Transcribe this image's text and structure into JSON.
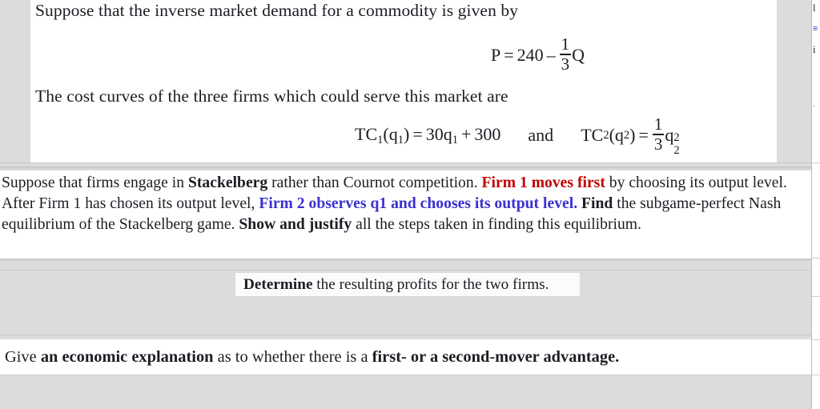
{
  "slide": {
    "background_color": "#dcdcdc",
    "panel_color": "#ffffff",
    "text_color": "#1c1c24",
    "accent_red": "#c00000",
    "accent_blue": "#3a31cf"
  },
  "demand_block": {
    "intro_line": "Suppose that the inverse market demand for a commodity is given by",
    "demand_equation": {
      "lhs": "P",
      "equals": "=",
      "constant": "240",
      "minus": "–",
      "fraction_numerator": "1",
      "fraction_denominator": "3",
      "variable": "Q",
      "plain_text": "P = 240 – (1/3)Q"
    },
    "cost_intro_line": "The cost curves of the three firms which could serve this market are",
    "cost_equations": {
      "firm1": {
        "function": "TC",
        "function_sub": "1",
        "arg": "q",
        "arg_sub": "1",
        "equals": "=",
        "coefficient": "30q",
        "coefficient_sub": "1",
        "plus": "+",
        "constant": "300",
        "plain_text": "TC1(q1) = 30q1 + 300"
      },
      "conjunction": "and",
      "firm2": {
        "function": "TC",
        "function_sub": "2",
        "arg": "q",
        "arg_sub": "2",
        "equals": "=",
        "fraction_numerator": "1",
        "fraction_denominator": "3",
        "variable": "q",
        "variable_sub": "2",
        "variable_sup": "2",
        "plain_text": "TC2(q2) = (1/3)q2^2"
      }
    }
  },
  "stackelberg_block": {
    "segments": [
      {
        "text": "Suppose that firms engage in ",
        "style": "normal"
      },
      {
        "text": "Stackelberg",
        "style": "bold"
      },
      {
        "text": " rather than Cournot competition. ",
        "style": "normal"
      },
      {
        "text": "Firm 1 moves first",
        "style": "red-bold"
      },
      {
        "text": " by choosing its output level. After Firm 1 has chosen its output level, ",
        "style": "normal"
      },
      {
        "text": "Firm 2 observes q1 and chooses its output level.",
        "style": "blue-bold"
      },
      {
        "text": " ",
        "style": "normal"
      },
      {
        "text": "Find",
        "style": "bold"
      },
      {
        "text": " the subgame-perfect Nash equilibrium of the Stackelberg game. ",
        "style": "normal"
      },
      {
        "text": "Show and justify",
        "style": "bold"
      },
      {
        "text": " all the steps taken in finding this equilibrium.",
        "style": "normal"
      }
    ]
  },
  "determine_block": {
    "segments": [
      {
        "text": "Determine",
        "style": "bold"
      },
      {
        "text": " the resulting profits for the two firms.",
        "style": "normal"
      }
    ]
  },
  "explanation_block": {
    "segments": [
      {
        "text": "Give ",
        "style": "normal"
      },
      {
        "text": "an economic explanation",
        "style": "bold"
      },
      {
        "text": " as to whether there is a ",
        "style": "normal"
      },
      {
        "text": "first- or a second-mover advantage.",
        "style": "bold"
      }
    ]
  },
  "right_strip": {
    "fragments": [
      "l",
      "≡",
      "i",
      "·"
    ]
  }
}
